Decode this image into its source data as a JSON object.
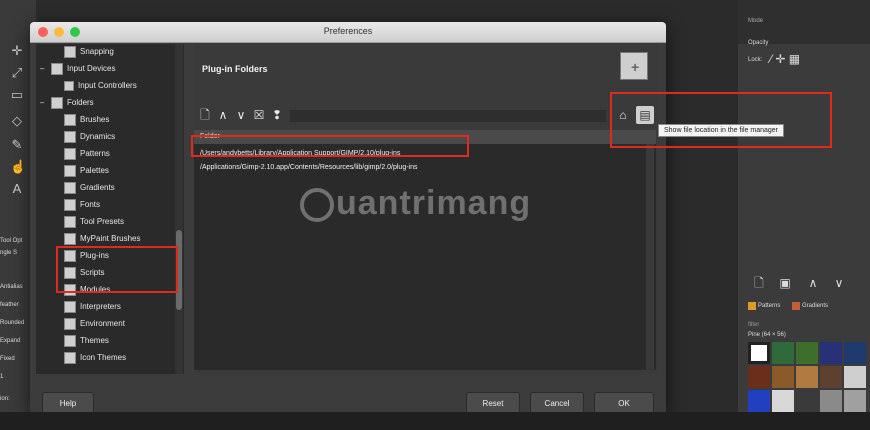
{
  "window": {
    "title": "Preferences"
  },
  "tree": {
    "items": [
      {
        "label": "Snapping"
      },
      {
        "label": "Input Devices"
      },
      {
        "label": "Input Controllers"
      },
      {
        "label": "Folders"
      },
      {
        "label": "Brushes"
      },
      {
        "label": "Dynamics"
      },
      {
        "label": "Patterns"
      },
      {
        "label": "Palettes"
      },
      {
        "label": "Gradients"
      },
      {
        "label": "Fonts"
      },
      {
        "label": "Tool Presets"
      },
      {
        "label": "MyPaint Brushes"
      },
      {
        "label": "Plug-ins"
      },
      {
        "label": "Scripts"
      },
      {
        "label": "Modules"
      },
      {
        "label": "Interpreters"
      },
      {
        "label": "Environment"
      },
      {
        "label": "Themes"
      },
      {
        "label": "Icon Themes"
      }
    ]
  },
  "panel": {
    "title": "Plug-in Folders",
    "column_header": "Folder",
    "rows": [
      "/Users/andybetts/Library/Application Support/GIMP/2.10/plug-ins",
      "/Applications/Gimp-2.10.app/Contents/Resources/lib/gimp/2.0/plug-ins"
    ],
    "tooltip": "Show file location in the file manager"
  },
  "buttons": {
    "help": "Help",
    "reset": "Reset",
    "cancel": "Cancel",
    "ok": "OK"
  },
  "right_panel": {
    "mode_label": "Mode",
    "opacity_label": "Opacity",
    "lock_label": "Lock:",
    "tabs": [
      "Patterns",
      "Gradients"
    ],
    "filter_label": "filter",
    "pattern_name": "Pine (64 × 56)"
  },
  "left_panel": {
    "labels": [
      "Tool Opt",
      "ngle S",
      "Antialias",
      "feather",
      "Rounded",
      "Expand",
      "Fixed",
      "1",
      "ion:"
    ]
  },
  "watermark": {
    "text": "uantrimang"
  },
  "colors": {
    "annotation": "#e02a1c",
    "dialog_bg": "#3c3c3c",
    "titlebar": "#dcdcdc"
  }
}
